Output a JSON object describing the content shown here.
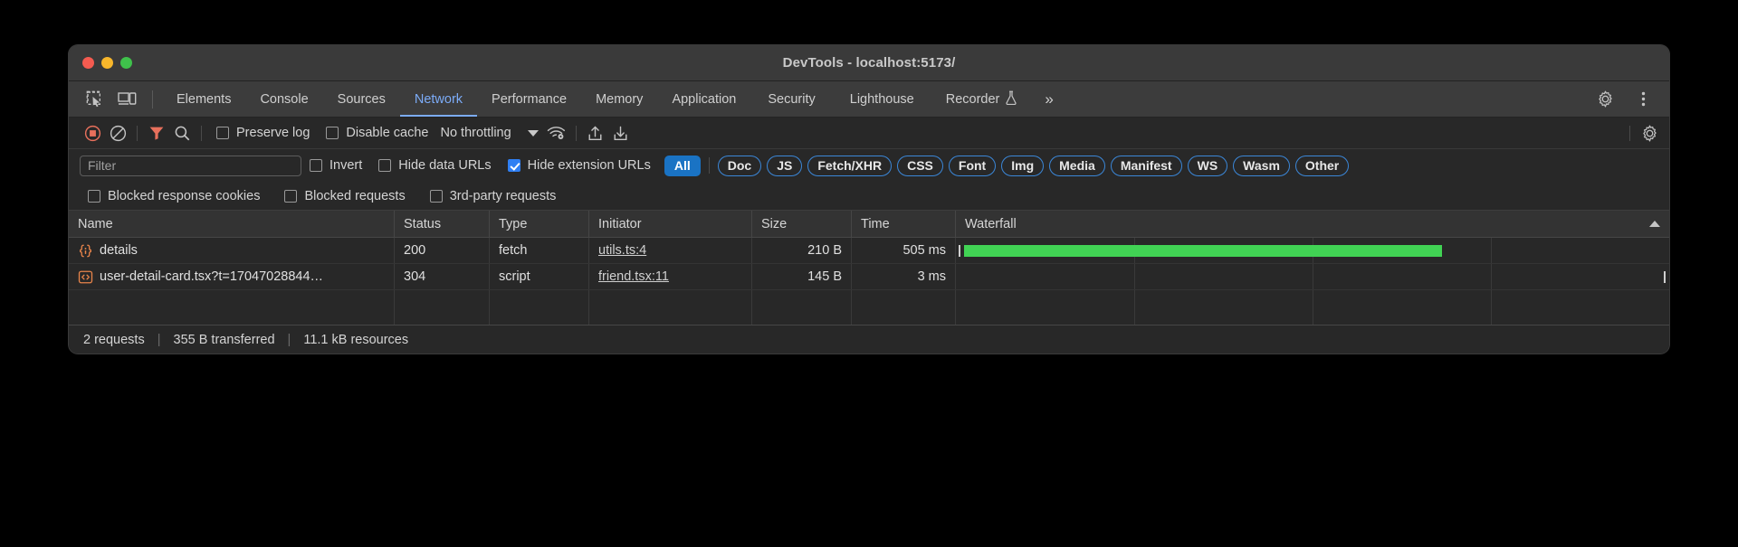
{
  "window": {
    "title": "DevTools - localhost:5173/",
    "traffic_lights": [
      "close",
      "minimize",
      "maximize"
    ],
    "colors": {
      "close": "#f45b50",
      "minimize": "#f7b62b",
      "maximize": "#3fc14b"
    }
  },
  "tabbar": {
    "left_icons": [
      {
        "name": "inspect-element-icon"
      },
      {
        "name": "device-toolbar-icon"
      }
    ],
    "tabs": [
      {
        "label": "Elements",
        "active": false
      },
      {
        "label": "Console",
        "active": false
      },
      {
        "label": "Sources",
        "active": false
      },
      {
        "label": "Network",
        "active": true
      },
      {
        "label": "Performance",
        "active": false
      },
      {
        "label": "Memory",
        "active": false
      },
      {
        "label": "Application",
        "active": false
      },
      {
        "label": "Security",
        "active": false
      },
      {
        "label": "Lighthouse",
        "active": false
      },
      {
        "label": "Recorder",
        "active": false,
        "icon": "experiment-flask-icon"
      }
    ],
    "overflow_label": "»",
    "right_icons": [
      {
        "name": "settings-gear-icon"
      },
      {
        "name": "more-options-icon"
      }
    ],
    "active_color": "#7cacf8"
  },
  "network_toolbar": {
    "record_button": {
      "name": "record-button",
      "title": "Stop recording",
      "color": "#e8705c"
    },
    "clear_button": {
      "name": "clear-button",
      "title": "Clear"
    },
    "filter_button": {
      "name": "filter-funnel-icon",
      "title": "Filter",
      "active": true,
      "color": "#e8705c"
    },
    "search_button": {
      "name": "search-icon",
      "title": "Search"
    },
    "preserve_log": {
      "label": "Preserve log",
      "checked": false
    },
    "disable_cache": {
      "label": "Disable cache",
      "checked": false
    },
    "throttling": {
      "value": "No throttling"
    },
    "network_conditions_icon": "wifi-settings-icon",
    "import_icon": "import-har-icon",
    "export_icon": "export-har-icon",
    "settings_icon": "network-settings-gear-icon"
  },
  "filter_bar": {
    "search": {
      "placeholder": "Filter",
      "value": ""
    },
    "invert": {
      "label": "Invert",
      "checked": false
    },
    "hide_data_urls": {
      "label": "Hide data URLs",
      "checked": false
    },
    "hide_extension_urls": {
      "label": "Hide extension URLs",
      "checked": true
    },
    "type_filters": [
      {
        "label": "All",
        "active": true
      },
      {
        "label": "Doc",
        "active": false
      },
      {
        "label": "JS",
        "active": false
      },
      {
        "label": "Fetch/XHR",
        "active": false
      },
      {
        "label": "CSS",
        "active": false
      },
      {
        "label": "Font",
        "active": false
      },
      {
        "label": "Img",
        "active": false
      },
      {
        "label": "Media",
        "active": false
      },
      {
        "label": "Manifest",
        "active": false
      },
      {
        "label": "WS",
        "active": false
      },
      {
        "label": "Wasm",
        "active": false
      },
      {
        "label": "Other",
        "active": false
      }
    ],
    "accent_color": "#1a73c4"
  },
  "checkbox_row": [
    {
      "label": "Blocked response cookies",
      "checked": false
    },
    {
      "label": "Blocked requests",
      "checked": false
    },
    {
      "label": "3rd-party requests",
      "checked": false
    }
  ],
  "requests_table": {
    "columns": [
      {
        "label": "Name"
      },
      {
        "label": "Status"
      },
      {
        "label": "Type"
      },
      {
        "label": "Initiator"
      },
      {
        "label": "Size"
      },
      {
        "label": "Time"
      },
      {
        "label": "Waterfall",
        "sorted": "asc"
      }
    ],
    "rows": [
      {
        "icon": "json-resource-icon",
        "name": "details",
        "status": "200",
        "type": "fetch",
        "initiator": "utils.ts:4",
        "size": "210 B",
        "time": "505 ms",
        "waterfall": {
          "start_pct": 0.5,
          "width_pct": 67.5,
          "color": "#41d354"
        }
      },
      {
        "icon": "script-resource-icon",
        "name": "user-detail-card.tsx?t=17047028844…",
        "status": "304",
        "type": "script",
        "initiator": "friend.tsx:11",
        "size": "145 B",
        "time": "3 ms",
        "waterfall": {
          "start_pct": 99.2,
          "width_pct": 0.5,
          "color": "#cfcfcf"
        }
      }
    ]
  },
  "status_bar": {
    "requests": "2 requests",
    "transferred": "355 B transferred",
    "resources": "11.1 kB resources",
    "separator": "|"
  }
}
